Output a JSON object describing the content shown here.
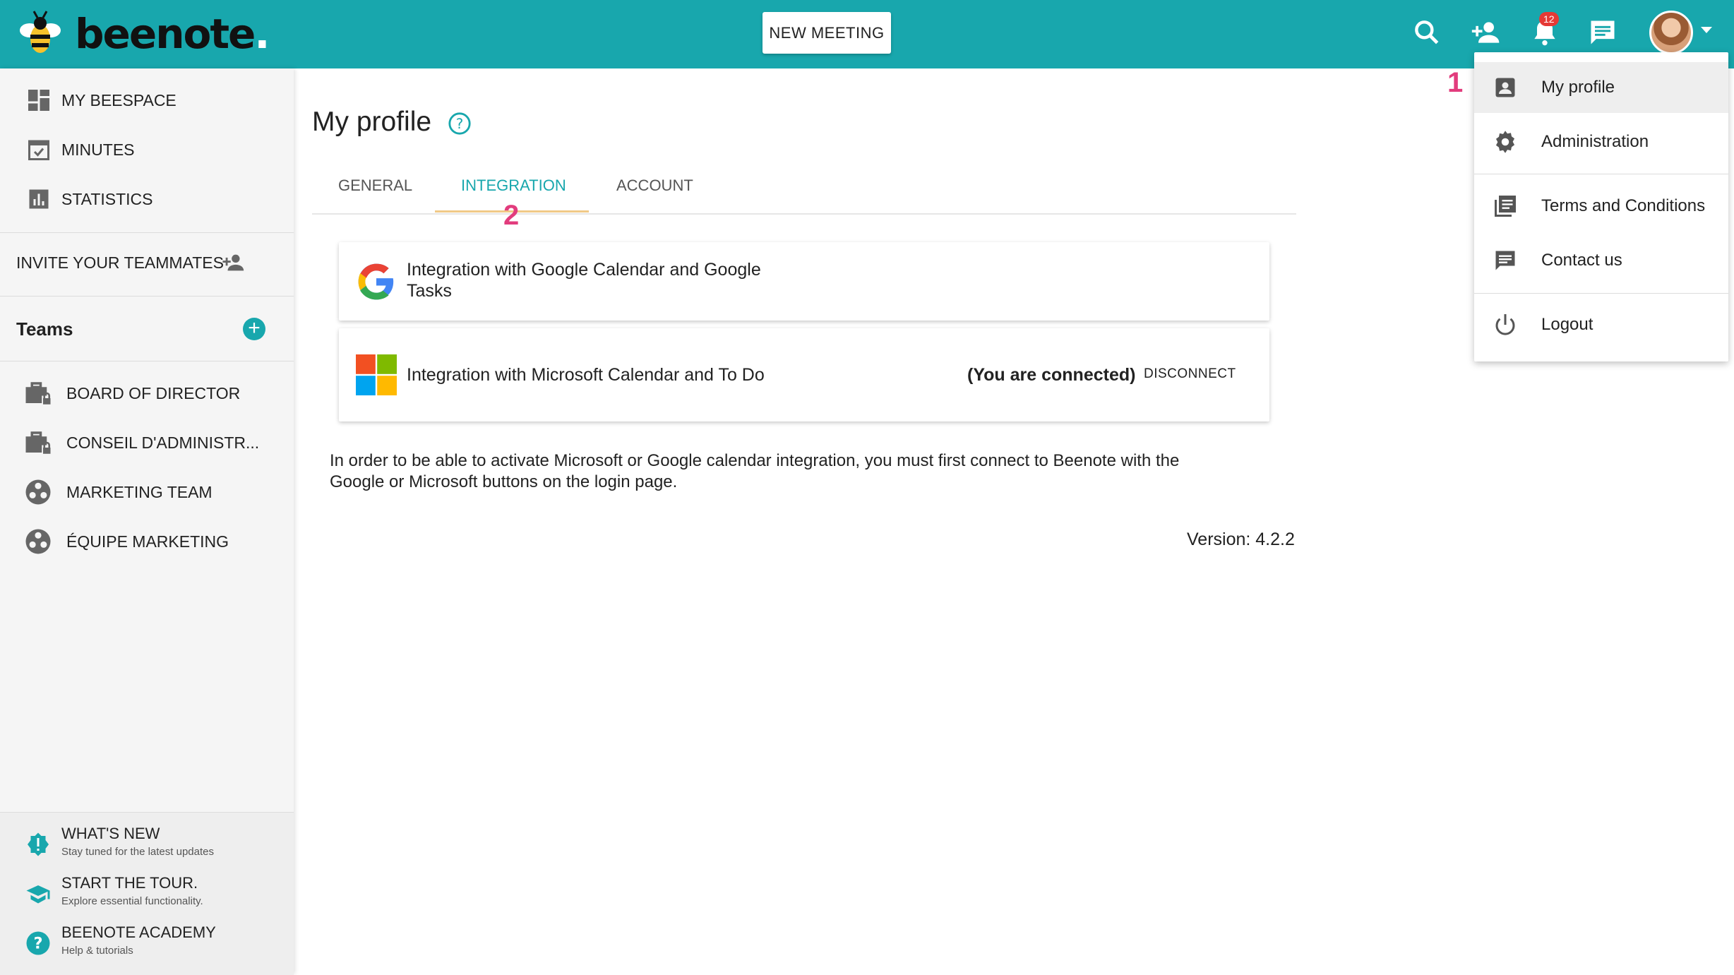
{
  "header": {
    "brand": "beenote",
    "brand_dot": ".",
    "new_meeting_label": "NEW MEETING",
    "notification_count": "12",
    "accent_color": "#18a7ad",
    "icons": [
      "search-icon",
      "add-person-icon",
      "bell-icon",
      "chat-icon",
      "avatar",
      "chevron-down-icon"
    ]
  },
  "sidebar": {
    "nav": [
      {
        "label": "MY BEESPACE",
        "icon": "dashboard-icon"
      },
      {
        "label": "MINUTES",
        "icon": "calendar-check-icon"
      },
      {
        "label": "STATISTICS",
        "icon": "bar-chart-icon"
      }
    ],
    "invite_label": "INVITE YOUR TEAMMATES",
    "teams_label": "Teams",
    "teams": [
      {
        "label": "BOARD OF DIRECTOR",
        "icon": "briefcase-lock-icon"
      },
      {
        "label": "CONSEIL D'ADMINISTR...",
        "icon": "briefcase-lock-icon"
      },
      {
        "label": "MARKETING TEAM",
        "icon": "team-icon"
      },
      {
        "label": "ÉQUIPE MARKETING",
        "icon": "team-icon"
      }
    ],
    "help": [
      {
        "title": "WHAT'S NEW",
        "subtitle": "Stay tuned for the latest updates",
        "icon": "alert-badge-icon"
      },
      {
        "title": "START THE TOUR.",
        "subtitle": "Explore essential functionality.",
        "icon": "graduation-cap-icon"
      },
      {
        "title": "BEENOTE ACADEMY",
        "subtitle": "Help & tutorials",
        "icon": "help-icon"
      }
    ]
  },
  "main": {
    "title": "My profile",
    "tabs": [
      {
        "label": "GENERAL"
      },
      {
        "label": "INTEGRATION",
        "active": true
      },
      {
        "label": "ACCOUNT"
      }
    ],
    "google_card": {
      "line1": "Integration with Google Calendar and Google",
      "line2": "Tasks"
    },
    "microsoft_card": {
      "text": "Integration with Microsoft Calendar and To Do",
      "status": "(You are connected)",
      "action": "DISCONNECT"
    },
    "info_line1": "In order to be able to activate Microsoft or Google calendar integration, you must first connect to Beenote with the",
    "info_line2": "Google or Microsoft buttons on the login page.",
    "version": "Version: 4.2.2"
  },
  "annotations": {
    "step1": "1",
    "step2": "2",
    "color": "#e23c7d"
  },
  "menu": {
    "items": [
      {
        "label": "My profile",
        "icon": "account-box-icon",
        "selected": true
      },
      {
        "label": "Administration",
        "icon": "gear-icon"
      },
      {
        "label": "Terms and Conditions",
        "icon": "document-list-icon"
      },
      {
        "label": "Contact us",
        "icon": "message-icon"
      },
      {
        "label": "Logout",
        "icon": "power-icon"
      }
    ]
  }
}
